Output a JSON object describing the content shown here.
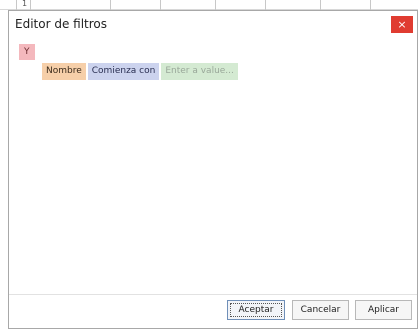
{
  "backdrop": {
    "stub_text": "1"
  },
  "dialog": {
    "title": "Editor de filtros",
    "close_label": "×"
  },
  "filter": {
    "group_operator": "Y",
    "condition": {
      "field": "Nombre",
      "operator": "Comienza con",
      "value_placeholder": "Enter a value..."
    }
  },
  "footer": {
    "ok_label": "Aceptar",
    "cancel_label": "Cancelar",
    "apply_label": "Aplicar"
  },
  "colors": {
    "close_button": "#e03c31",
    "group_operator": "#f4b8bd",
    "field_chip": "#f6cfa9",
    "operator_chip": "#ccd3ee",
    "value_chip": "#d4ead2"
  }
}
